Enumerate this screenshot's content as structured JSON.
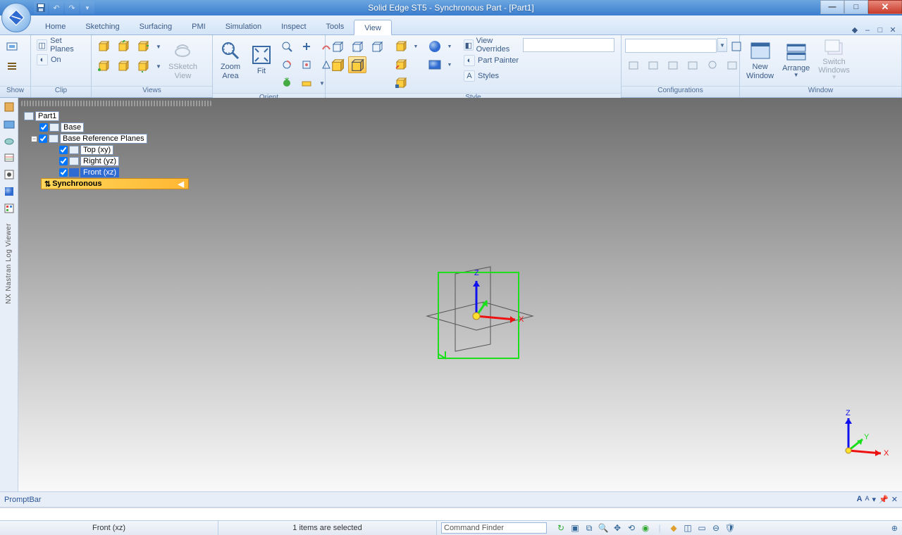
{
  "title": "Solid Edge ST5 - Synchronous Part - [Part1]",
  "tabs": [
    "Home",
    "Sketching",
    "Surfacing",
    "PMI",
    "Simulation",
    "Inspect",
    "Tools",
    "View"
  ],
  "activeTab": "View",
  "ribbon": {
    "show": {
      "label": "Show"
    },
    "clip": {
      "label": "Clip",
      "setPlanes": "Set Planes",
      "on": "On"
    },
    "views": {
      "label": "Views",
      "sketchView": "Sketch View"
    },
    "orient": {
      "label": "Orient",
      "zoomArea": "Zoom Area",
      "fit": "Fit"
    },
    "style": {
      "label": "Style",
      "viewOverrides": "View Overrides",
      "partPainter": "Part Painter",
      "styles": "Styles"
    },
    "config": {
      "label": "Configurations"
    },
    "window": {
      "label": "Window",
      "newWindow": "New Window",
      "arrange": "Arrange",
      "switchWindows": "Switch Windows"
    }
  },
  "tree": {
    "root": "Part1",
    "base": "Base",
    "refPlanes": "Base Reference Planes",
    "planes": [
      "Top (xy)",
      "Right (yz)",
      "Front (xz)"
    ],
    "sync": "Synchronous"
  },
  "sideLabel": "NX Nastran Log Viewer",
  "promptBar": "PromptBar",
  "status": {
    "view": "Front (xz)",
    "selection": "1 items are selected",
    "cmdFinder": "Command Finder"
  },
  "axis": {
    "x": "X",
    "y": "Y",
    "z": "Z"
  }
}
